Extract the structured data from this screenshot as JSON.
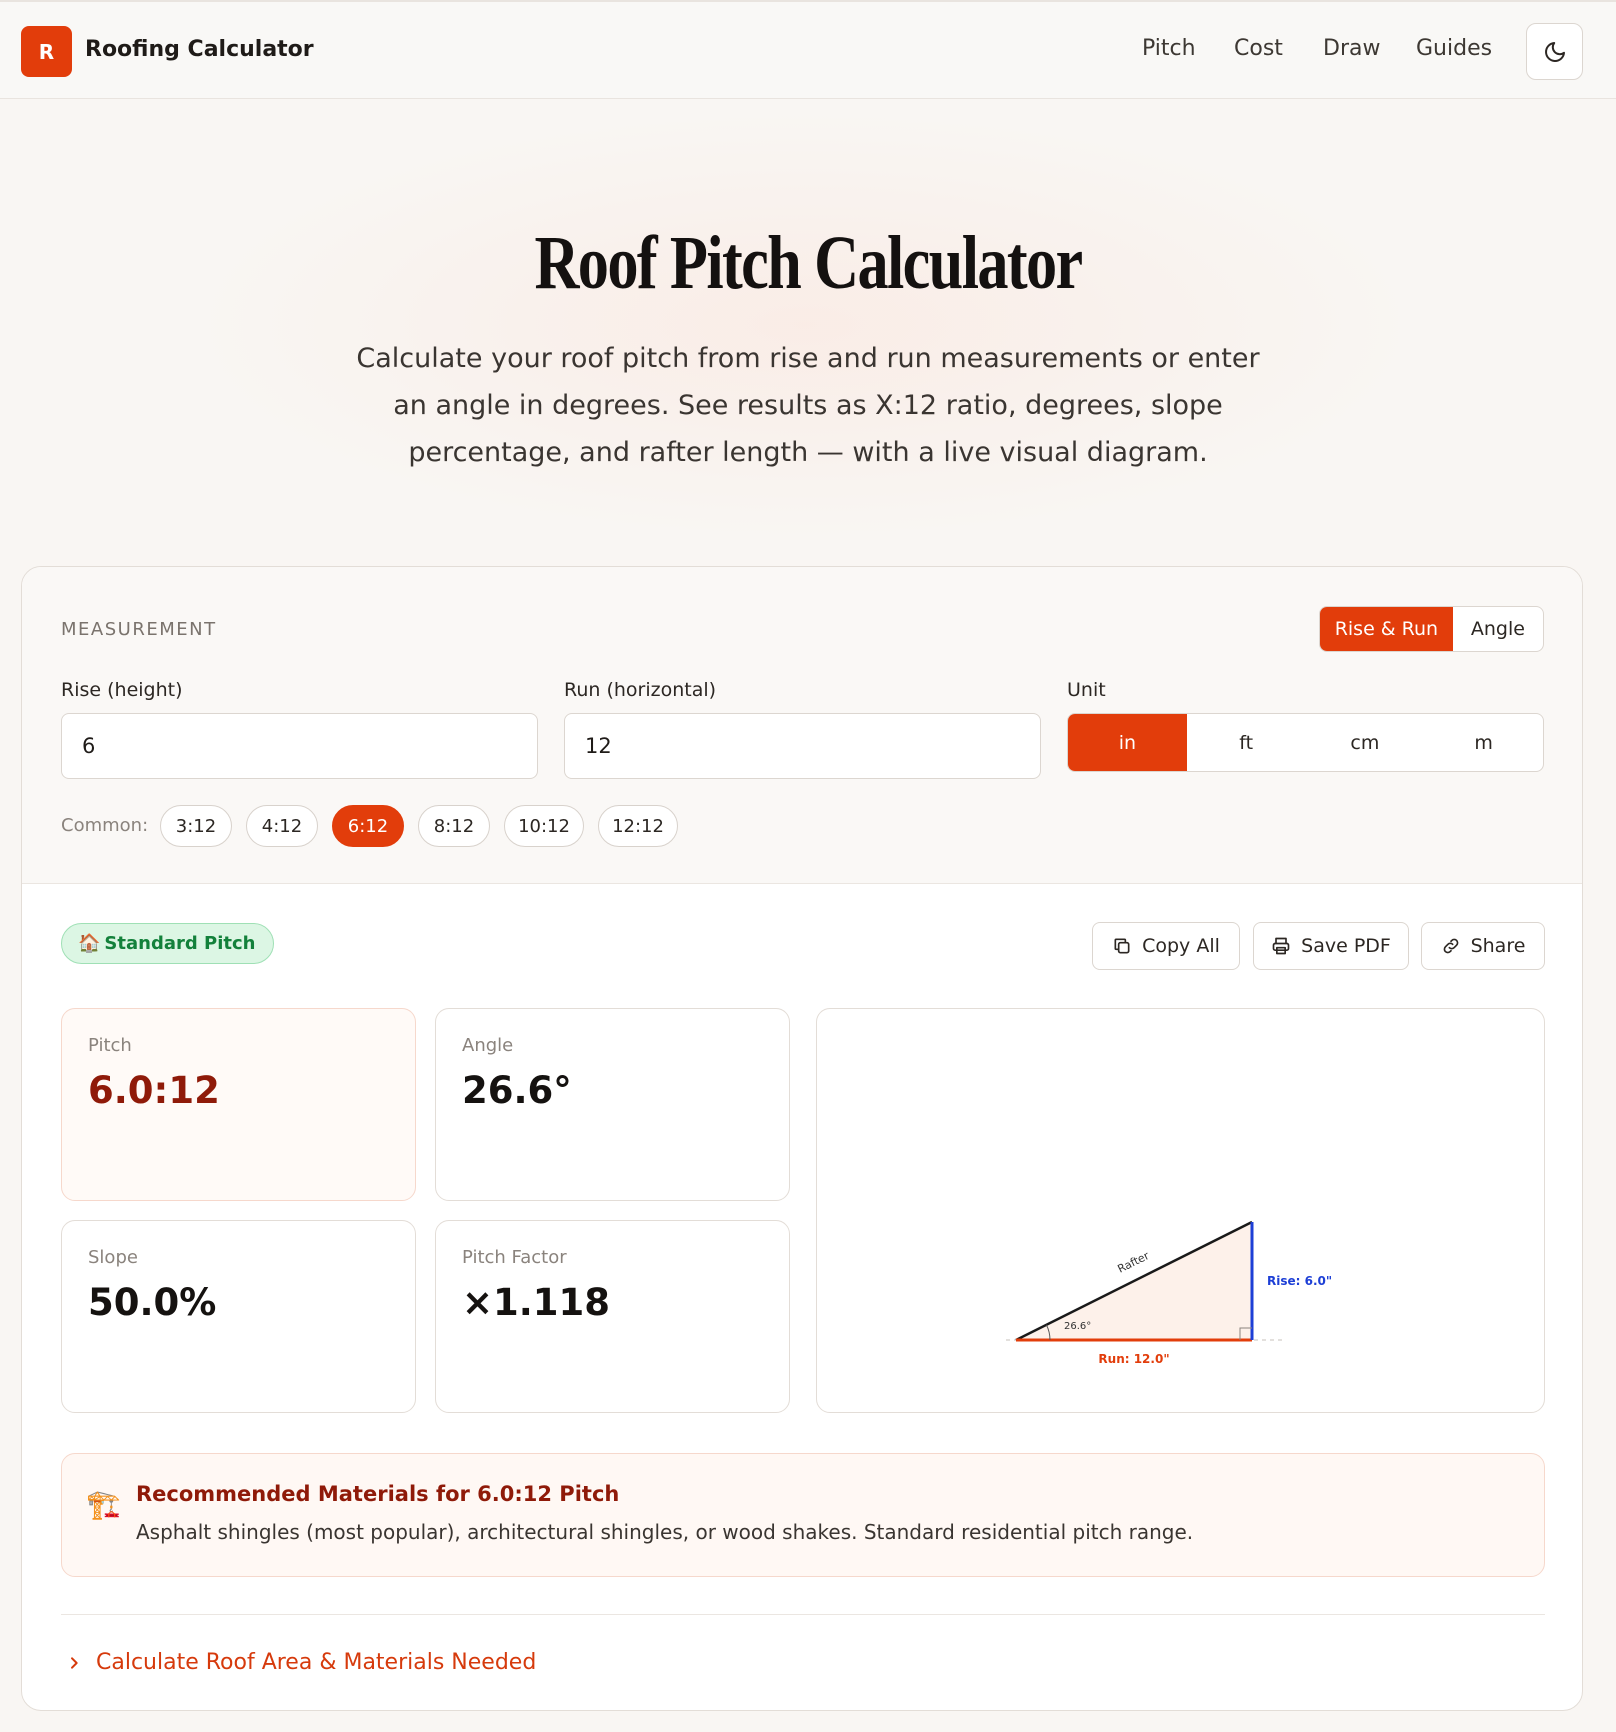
{
  "header": {
    "logo_letter": "R",
    "brand": "Roofing Calculator",
    "nav": [
      "Pitch",
      "Cost",
      "Draw",
      "Guides"
    ]
  },
  "hero": {
    "title": "Roof Pitch Calculator",
    "subtitle": "Calculate your roof pitch from rise and run measurements or enter an angle in degrees. See results as X:12 ratio, degrees, slope percentage, and rafter length — with a live visual diagram."
  },
  "measurement": {
    "section_label": "MEASUREMENT",
    "mode": {
      "options": [
        "Rise & Run",
        "Angle"
      ],
      "selected": "Rise & Run"
    },
    "rise_label": "Rise (height)",
    "rise_value": "6",
    "run_label": "Run (horizontal)",
    "run_value": "12",
    "unit_label": "Unit",
    "units": [
      "in",
      "ft",
      "cm",
      "m"
    ],
    "unit_selected": "in",
    "common_label": "Common:",
    "common": [
      "3:12",
      "4:12",
      "6:12",
      "8:12",
      "10:12",
      "12:12"
    ],
    "common_selected": "6:12"
  },
  "results": {
    "badge_icon": "🏠",
    "badge": "Standard Pitch",
    "actions": {
      "copy": "Copy All",
      "pdf": "Save PDF",
      "share": "Share"
    },
    "pitch_label": "Pitch",
    "pitch_value": "6.0:12",
    "angle_label": "Angle",
    "angle_value": "26.6°",
    "slope_label": "Slope",
    "slope_value": "50.0%",
    "factor_label": "Pitch Factor",
    "factor_value": "×1.118"
  },
  "diagram": {
    "rafter_label": "Rafter",
    "angle_label": "26.6°",
    "rise_label": "Rise: 6.0\"",
    "run_label": "Run: 12.0\"",
    "rise": 6,
    "run": 12
  },
  "recommendation": {
    "icon": "🏗️",
    "title": "Recommended Materials for 6.0:12 Pitch",
    "text": "Asphalt shingles (most popular), architectural shingles, or wood shakes. Standard residential pitch range."
  },
  "expand_label": "Calculate Roof Area & Materials Needed",
  "colors": {
    "accent": "#e23d0b",
    "rise_line": "#1d3fd6",
    "badge_green": "#13813b"
  }
}
